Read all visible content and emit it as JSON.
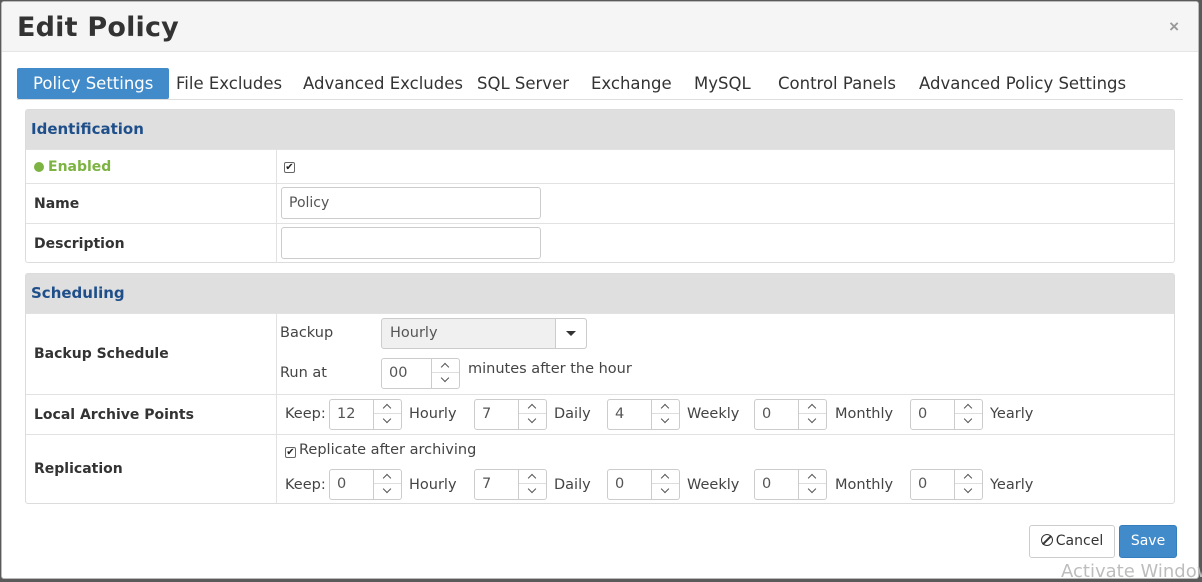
{
  "modal": {
    "title": "Edit Policy",
    "close_symbol": "×"
  },
  "tabs": [
    {
      "label": "Policy Settings",
      "active": true
    },
    {
      "label": "File Excludes"
    },
    {
      "label": "Advanced Excludes"
    },
    {
      "label": "SQL Server"
    },
    {
      "label": "Exchange"
    },
    {
      "label": "MySQL"
    },
    {
      "label": "Control Panels"
    },
    {
      "label": "Advanced Policy Settings"
    }
  ],
  "identification": {
    "heading": "Identification",
    "enabled_label": "Enabled",
    "enabled_checked": true,
    "name_label": "Name",
    "name_value": "Policy",
    "description_label": "Description",
    "description_value": ""
  },
  "scheduling": {
    "heading": "Scheduling",
    "backup_schedule_label": "Backup Schedule",
    "backup_label": "Backup",
    "backup_value": "Hourly",
    "run_at_label": "Run at",
    "run_at_value": "00",
    "run_at_suffix": "minutes after the hour",
    "local_archive_label": "Local Archive Points",
    "keep_label": "Keep:",
    "units": {
      "hourly": "Hourly",
      "daily": "Daily",
      "weekly": "Weekly",
      "monthly": "Monthly",
      "yearly": "Yearly"
    },
    "local_archive": {
      "hourly": "12",
      "daily": "7",
      "weekly": "4",
      "monthly": "0",
      "yearly": "0"
    },
    "replication_label": "Replication",
    "replicate_checkbox_label": "Replicate after archiving",
    "replicate_checked": true,
    "replication": {
      "hourly": "0",
      "daily": "7",
      "weekly": "0",
      "monthly": "0",
      "yearly": "0"
    }
  },
  "footer": {
    "cancel_label": "Cancel",
    "save_label": "Save"
  },
  "watermark": "Activate Window",
  "colors": {
    "primary": "#428bca",
    "enabled_green": "#7cb342",
    "section_heading": "#1f4f8a"
  }
}
